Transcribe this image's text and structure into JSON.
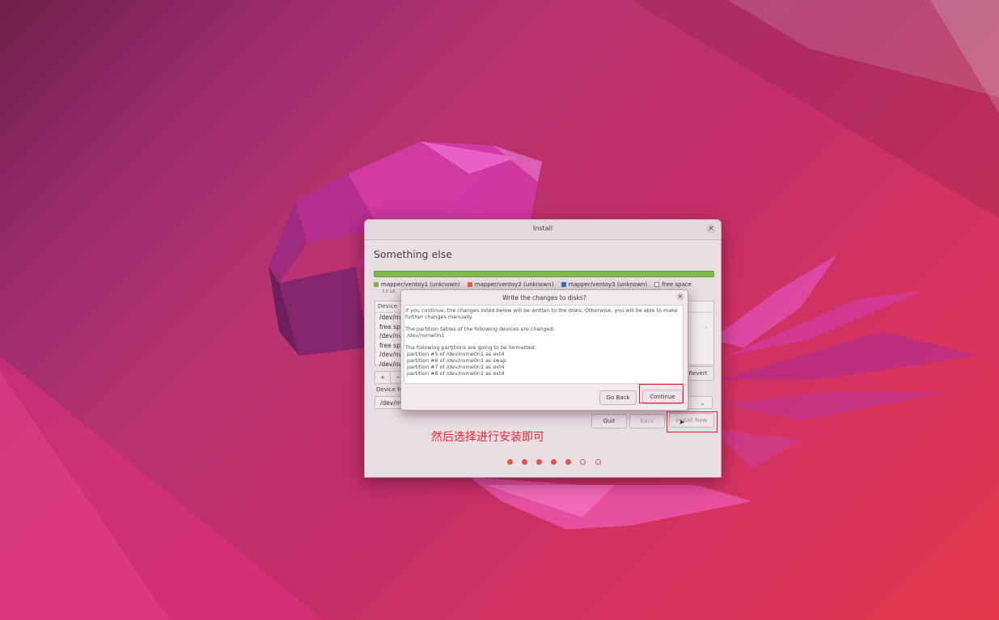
{
  "installer": {
    "title": "Install",
    "close_icon": "close-icon",
    "heading": "Something else",
    "legend": [
      {
        "label": "mapper/ventoy1 (unknown)",
        "color": "#7cb94a"
      },
      {
        "label": "mapper/ventoy2 (unknown)",
        "color": "#e0663f"
      },
      {
        "label": "mapper/ventoy3 (unknown)",
        "color": "#3f6fb5"
      },
      {
        "label": "free space",
        "color": "#ffffff"
      }
    ],
    "legend_sub": "3.8 GB",
    "table": {
      "column_device": "Device",
      "rows": [
        "/dev/nv",
        "free spa",
        "/dev/nv",
        "free spa",
        "/dev/nv",
        "/dev/nv"
      ]
    },
    "add_button": "+",
    "remove_button": "−",
    "revert_button": "Revert",
    "boot_device_label": "Device fo",
    "boot_device_value": "/dev/nv",
    "quit_button": "Quit",
    "back_button": "Back",
    "install_now_button": "Install Now",
    "progress_dots": {
      "completed": 5,
      "total": 7
    }
  },
  "dialog": {
    "title": "Write the changes to disks?",
    "lines": [
      "If you continue, the changes listed below will be written to the disks. Otherwise, you will be able to make",
      "further changes manually.",
      "",
      "The partition tables of the following devices are changed:",
      " /dev/nvme0n1",
      "",
      "The following partitions are going to be formatted:",
      " partition #5 of /dev/nvme0n1 as ext4",
      " partition #6 of /dev/nvme0n1 as swap",
      " partition #7 of /dev/nvme0n1 as ext4",
      " partition #8 of /dev/nvme0n1 as ext4"
    ],
    "go_back_button": "Go Back",
    "continue_button": "Continue"
  },
  "annotation": {
    "caption": "然后选择进行安装即可",
    "highlight_color": "#e02020"
  }
}
